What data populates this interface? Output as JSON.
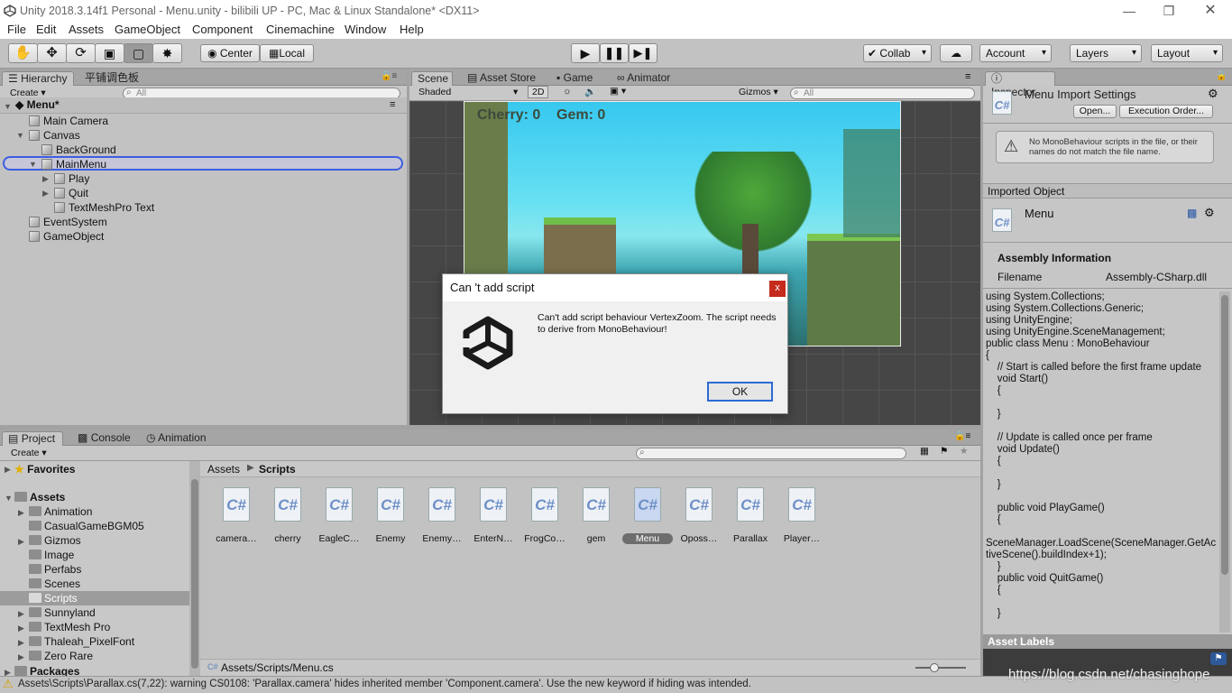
{
  "window": {
    "title": "Unity 2018.3.14f1 Personal - Menu.unity - bilibili UP - PC, Mac & Linux Standalone* <DX11>"
  },
  "menu": [
    "File",
    "Edit",
    "Assets",
    "GameObject",
    "Component",
    "Cinemachine",
    "Window",
    "Help"
  ],
  "toolbar": {
    "tools": [
      "hand-icon",
      "move-icon",
      "rotate-icon",
      "scale-icon",
      "rect-icon",
      "transform-icon"
    ],
    "pivot": "Center",
    "space": "Local",
    "collab": "Collab",
    "account": "Account",
    "layers": "Layers",
    "layout": "Layout"
  },
  "hierarchy": {
    "tabs": [
      "Hierarchy",
      "平铺调色板"
    ],
    "create": "Create",
    "search_placeholder": "All",
    "scene": "Menu*",
    "items": [
      "Main Camera",
      "Canvas",
      "BackGround",
      "MainMenu",
      "Play",
      "Quit",
      "TextMeshPro Text",
      "EventSystem",
      "GameObject"
    ]
  },
  "scene": {
    "tabs": [
      "Scene",
      "Asset Store",
      "Game",
      "Animator"
    ],
    "shading": "Shaded",
    "mode2d": "2D",
    "gizmos": "Gizmos",
    "search_placeholder": "All",
    "hud": "Cherry: 0    Gem: 0"
  },
  "inspector": {
    "tab": "Inspector",
    "title": "Menu Import Settings",
    "open": "Open...",
    "exec": "Execution Order...",
    "warning": "No MonoBehaviour scripts in the file, or their names do not match the file name.",
    "imported": "Imported Object",
    "object": "Menu",
    "assembly_heading": "Assembly Information",
    "filename_label": "Filename",
    "filename_value": "Assembly-CSharp.dll",
    "code": "using System.Collections;\nusing System.Collections.Generic;\nusing UnityEngine;\nusing UnityEngine.SceneManagement;\npublic class Menu : MonoBehaviour\n{\n    // Start is called before the first frame update\n    void Start()\n    {\n\n    }\n\n    // Update is called once per frame\n    void Update()\n    {\n\n    }\n\n    public void PlayGame()\n    {\n\nSceneManager.LoadScene(SceneManager.GetActiveScene().buildIndex+1);\n    }\n    public void QuitGame()\n    {\n\n    }",
    "asset_labels": "Asset Labels"
  },
  "project": {
    "tabs": [
      "Project",
      "Console",
      "Animation"
    ],
    "create": "Create",
    "favorites": "Favorites",
    "assets": "Assets",
    "folders": [
      "Animation",
      "CasualGameBGM05",
      "Gizmos",
      "Image",
      "Perfabs",
      "Scenes",
      "Scripts",
      "Sunnyland",
      "TextMesh Pro",
      "Thaleah_PixelFont",
      "Zero Rare"
    ],
    "packages": "Packages",
    "breadcrumb": [
      "Assets",
      "Scripts"
    ],
    "files": [
      "camera…",
      "cherry",
      "EagleC…",
      "Enemy",
      "Enemy…",
      "EnterN…",
      "FrogCo…",
      "gem",
      "Menu",
      "Oposs…",
      "Parallax",
      "Player…"
    ],
    "path": "Assets/Scripts/Menu.cs"
  },
  "dialog": {
    "title": "Can 't add script",
    "message": "Can't add script behaviour VertexZoom. The script needs to derive from MonoBehaviour!",
    "ok": "OK"
  },
  "status": "Assets\\Scripts\\Parallax.cs(7,22): warning CS0108: 'Parallax.camera' hides inherited member 'Component.camera'. Use the new keyword if hiding was intended.",
  "watermark": "https://blog.csdn.net/chasinghope"
}
